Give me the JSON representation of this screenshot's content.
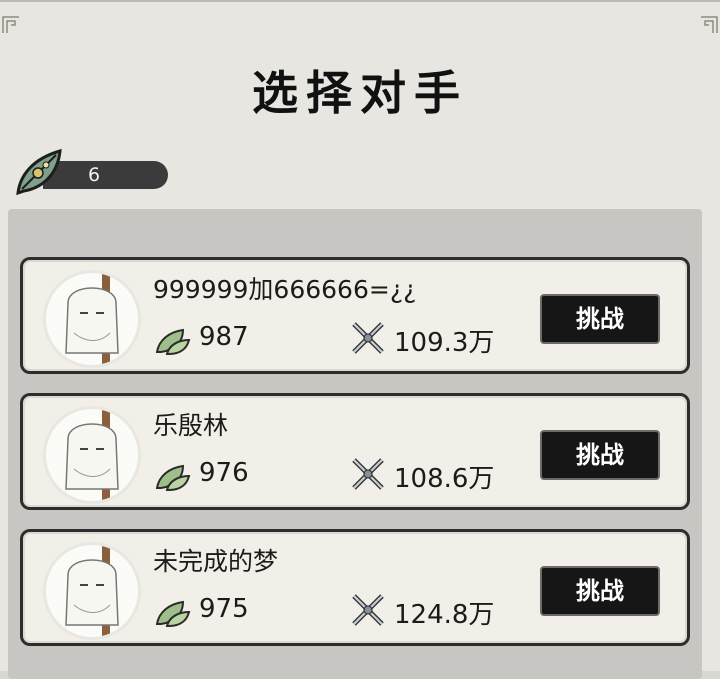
{
  "page": {
    "title": "选择对手"
  },
  "currency": {
    "count": "6",
    "icon": "leaf-token-icon"
  },
  "opponents": [
    {
      "name": "999999加666666=¿¿",
      "stat1": "987",
      "stat2": "109.3万",
      "button": "挑战"
    },
    {
      "name": "乐殷林",
      "stat1": "976",
      "stat2": "108.6万",
      "button": "挑战"
    },
    {
      "name": "未完成的梦",
      "stat1": "975",
      "stat2": "124.8万",
      "button": "挑战"
    }
  ],
  "colors": {
    "background": "#e8e6e1",
    "card": "#f1efe7",
    "button": "#161616",
    "pill": "#3b3b3b"
  }
}
